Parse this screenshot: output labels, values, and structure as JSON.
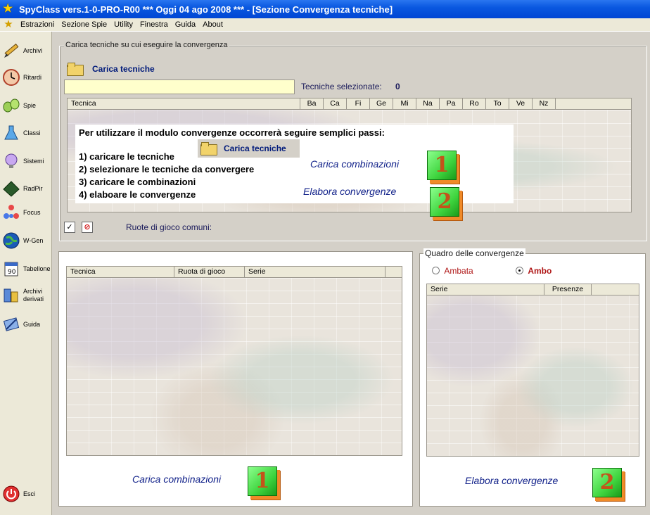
{
  "window": {
    "title": "SpyClass vers.1-0-PRO-R00  ***  Oggi 04 ago 2008  ***   - [Sezione Convergenza tecniche]"
  },
  "menu": [
    "Estrazioni",
    "Sezione Spie",
    "Utility",
    "Finestra",
    "Guida",
    "About"
  ],
  "sidebar": [
    {
      "label": "Archivi",
      "icon": "pencil-icon"
    },
    {
      "label": "Ritardi",
      "icon": "clock-icon"
    },
    {
      "label": "Spie",
      "icon": "binoculars-icon"
    },
    {
      "label": "Classi",
      "icon": "flask-icon"
    },
    {
      "label": "Sistemi",
      "icon": "lightbulb-icon"
    },
    {
      "label": "RadPir",
      "icon": "pyramid-icon"
    },
    {
      "label": "Focus",
      "icon": "molecule-icon"
    },
    {
      "label": "W-Gen",
      "icon": "globe-icon"
    },
    {
      "label": "Tabellone",
      "icon": "calendar-icon"
    },
    {
      "label": "Archivi\nderivati",
      "icon": "archive-derivati-icon"
    },
    {
      "label": "Guida",
      "icon": "guide-icon"
    },
    {
      "label": "Esci",
      "icon": "power-icon"
    }
  ],
  "top_section": {
    "group_label": "Carica tecniche su cui eseguire la convergenza",
    "load_button": "Carica tecniche",
    "selected_label": "Tecniche selezionate:",
    "selected_count": "0",
    "columns": [
      "Tecnica",
      "Ba",
      "Ca",
      "Fi",
      "Ge",
      "Mi",
      "Na",
      "Pa",
      "Ro",
      "To",
      "Ve",
      "Nz"
    ],
    "instructions": {
      "heading": "Per utilizzare il modulo convergenze occorrerà seguire semplici passi:",
      "steps": [
        "1) caricare le tecniche",
        "2) selezionare le tecniche da convergere",
        "3) caricare le combinazioni",
        "4) elaboare le convergenze"
      ],
      "inline_button": "Carica tecniche",
      "action1": "Carica combinazioni",
      "action2": "Elabora convergenze",
      "num1": "1",
      "num2": "2"
    },
    "ruote_label": "Ruote di gioco comuni:",
    "check_symbol": "✓",
    "cancel_symbol": "⊘"
  },
  "left_grid": {
    "columns": [
      "Tecnica",
      "Ruota di gioco",
      "Serie"
    ],
    "action": "Carica combinazioni",
    "num": "1"
  },
  "right_panel": {
    "group_label": "Quadro delle convergenze",
    "radio_ambata": "Ambata",
    "radio_ambo": "Ambo",
    "selected": "Ambo",
    "columns": [
      "Serie",
      "Presenze"
    ],
    "action": "Elabora convergenze",
    "num": "2"
  },
  "colors": {
    "title_blue": "#0a58e0",
    "link_blue": "#12228a",
    "radio_label_red": "#b01818",
    "accent_green": "#3ed43e",
    "accent_orange": "#f08a28"
  }
}
